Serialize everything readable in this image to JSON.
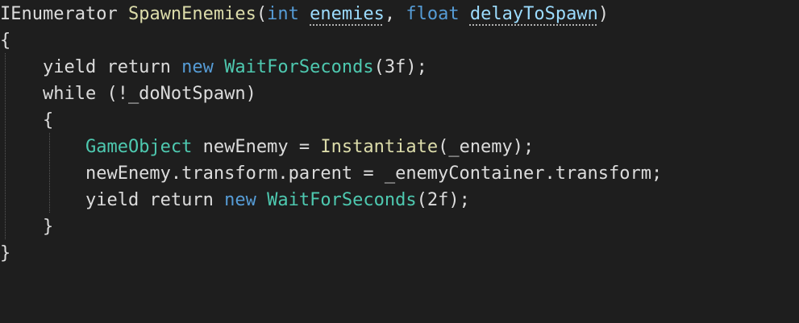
{
  "editor": {
    "background": "#1e1e1e",
    "colors": {
      "keyword": "#569cd6",
      "type": "#4ec9b0",
      "method": "#dcdcaa",
      "plain": "#dcdcdc",
      "parameter": "#9cdcfe"
    },
    "lines": [
      {
        "tokens": [
          {
            "text": "IEnumerator ",
            "kind": "pl"
          },
          {
            "text": "SpawnEnemies",
            "kind": "fn"
          },
          {
            "text": "(",
            "kind": "pl"
          },
          {
            "text": "int",
            "kind": "kw"
          },
          {
            "text": " ",
            "kind": "pl"
          },
          {
            "text": "enemies",
            "kind": "pa",
            "warn": true
          },
          {
            "text": ", ",
            "kind": "pl"
          },
          {
            "text": "float",
            "kind": "kw"
          },
          {
            "text": " ",
            "kind": "pl"
          },
          {
            "text": "delayToSpawn",
            "kind": "pa",
            "warn": true
          },
          {
            "text": ")",
            "kind": "pl"
          }
        ]
      },
      {
        "tokens": [
          {
            "text": "{",
            "kind": "pl"
          }
        ]
      },
      {
        "tokens": [
          {
            "text": "    yield return ",
            "kind": "pl"
          },
          {
            "text": "new",
            "kind": "kw"
          },
          {
            "text": " ",
            "kind": "pl"
          },
          {
            "text": "WaitForSeconds",
            "kind": "ty"
          },
          {
            "text": "(3f);",
            "kind": "pl"
          }
        ]
      },
      {
        "tokens": [
          {
            "text": "    while (!_doNotSpawn)",
            "kind": "pl"
          }
        ]
      },
      {
        "tokens": [
          {
            "text": "    {",
            "kind": "pl"
          }
        ]
      },
      {
        "tokens": [
          {
            "text": "        ",
            "kind": "pl"
          },
          {
            "text": "GameObject",
            "kind": "ty"
          },
          {
            "text": " newEnemy = ",
            "kind": "pl"
          },
          {
            "text": "Instantiate",
            "kind": "fn"
          },
          {
            "text": "(_enemy);",
            "kind": "pl"
          }
        ]
      },
      {
        "tokens": [
          {
            "text": "        newEnemy.transform.parent = _enemyContainer.transform;",
            "kind": "pl"
          }
        ]
      },
      {
        "tokens": [
          {
            "text": "        yield return ",
            "kind": "pl"
          },
          {
            "text": "new",
            "kind": "kw"
          },
          {
            "text": " ",
            "kind": "pl"
          },
          {
            "text": "WaitForSeconds",
            "kind": "ty"
          },
          {
            "text": "(2f);",
            "kind": "pl"
          }
        ]
      },
      {
        "tokens": [
          {
            "text": "    }",
            "kind": "pl"
          }
        ]
      },
      {
        "tokens": [
          {
            "text": "}",
            "kind": "pl"
          }
        ]
      }
    ]
  }
}
